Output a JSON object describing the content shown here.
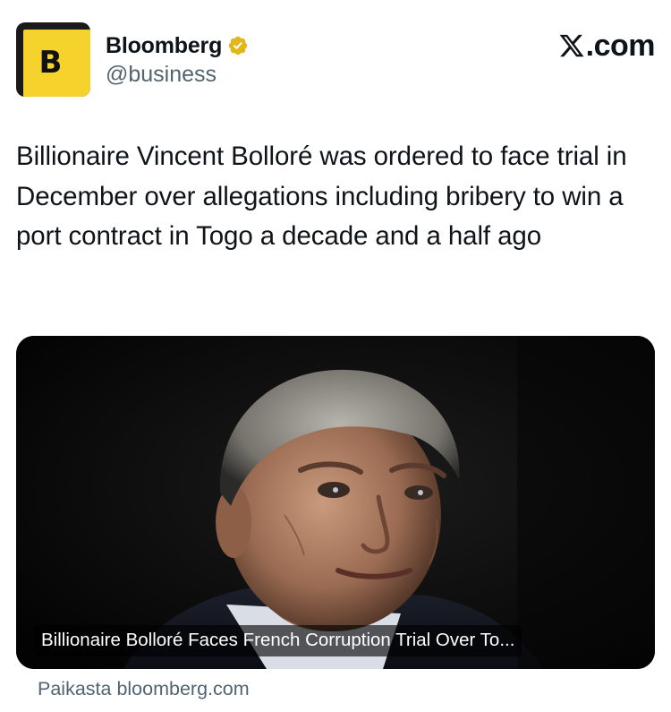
{
  "account": {
    "avatar_letter": "B",
    "name": "Bloomberg",
    "handle": "@business",
    "verified_icon": "verified-badge-icon",
    "verified_color": "#e2b719"
  },
  "brand": {
    "site": ".com",
    "logo_icon": "x-logo-icon"
  },
  "tweet": {
    "text": "Billionaire Vincent Bolloré was ordered to face trial in December over allegations including bribery to win a port contract in Togo a decade and a half ago"
  },
  "card": {
    "caption": "Billionaire Bolloré Faces French Corruption Trial Over To...",
    "image_subject": "portrait-photo"
  },
  "source": {
    "prefix": "Paikasta",
    "domain": "bloomberg.com"
  },
  "colors": {
    "avatar_yellow": "#f6d32c",
    "text_primary": "#0f1419",
    "text_secondary": "#536471"
  }
}
